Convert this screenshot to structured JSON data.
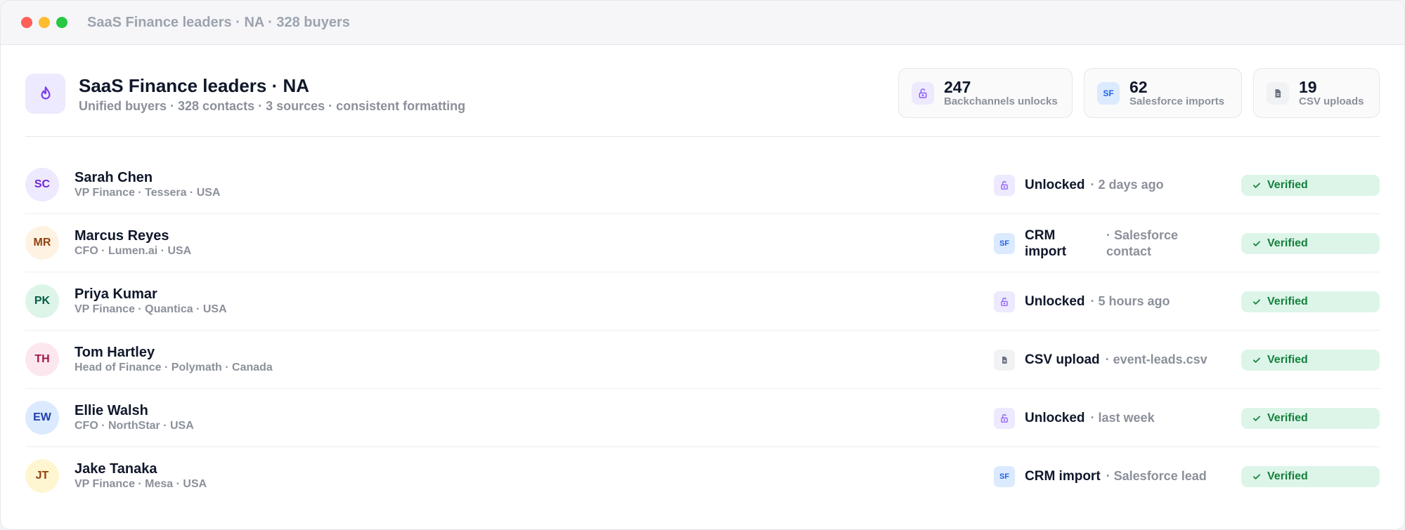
{
  "window": {
    "title": "SaaS Finance leaders · NA · 328 buyers"
  },
  "header": {
    "title": "SaaS Finance leaders · NA",
    "subtitle": "Unified buyers · 328 contacts · 3 sources · consistent formatting",
    "icon": "flame-icon"
  },
  "stats": [
    {
      "value": "247",
      "label": "Backchannels unlocks",
      "icon": "unlock-icon"
    },
    {
      "value": "62",
      "label": "Salesforce imports",
      "icon_text": "SF"
    },
    {
      "value": "19",
      "label": "CSV uploads",
      "icon": "file-icon"
    }
  ],
  "contacts": [
    {
      "initials": "SC",
      "name": "Sarah Chen",
      "meta": "VP Finance · Tessera · USA",
      "source": "Unlocked",
      "detail": "· 2 days ago",
      "status": "Verified"
    },
    {
      "initials": "MR",
      "name": "Marcus Reyes",
      "meta": "CFO · Lumen.ai · USA",
      "source": "CRM import",
      "detail": "· Salesforce contact",
      "source_icon_text": "SF",
      "status": "Verified"
    },
    {
      "initials": "PK",
      "name": "Priya Kumar",
      "meta": "VP Finance · Quantica · USA",
      "source": "Unlocked",
      "detail": "· 5 hours ago",
      "status": "Verified"
    },
    {
      "initials": "TH",
      "name": "Tom Hartley",
      "meta": "Head of Finance · Polymath · Canada",
      "source": "CSV upload",
      "detail": "· event-leads.csv",
      "status": "Verified"
    },
    {
      "initials": "EW",
      "name": "Ellie Walsh",
      "meta": "CFO · NorthStar · USA",
      "source": "Unlocked",
      "detail": "· last week",
      "status": "Verified"
    },
    {
      "initials": "JT",
      "name": "Jake Tanaka",
      "meta": "VP Finance · Mesa · USA",
      "source": "CRM import",
      "detail": "· Salesforce lead",
      "source_icon_text": "SF",
      "status": "Verified"
    }
  ],
  "colors": {
    "accent": "#7c3aed",
    "verified_bg": "#dcf5e8",
    "verified_text": "#15803d",
    "salesforce": "#2563eb"
  }
}
